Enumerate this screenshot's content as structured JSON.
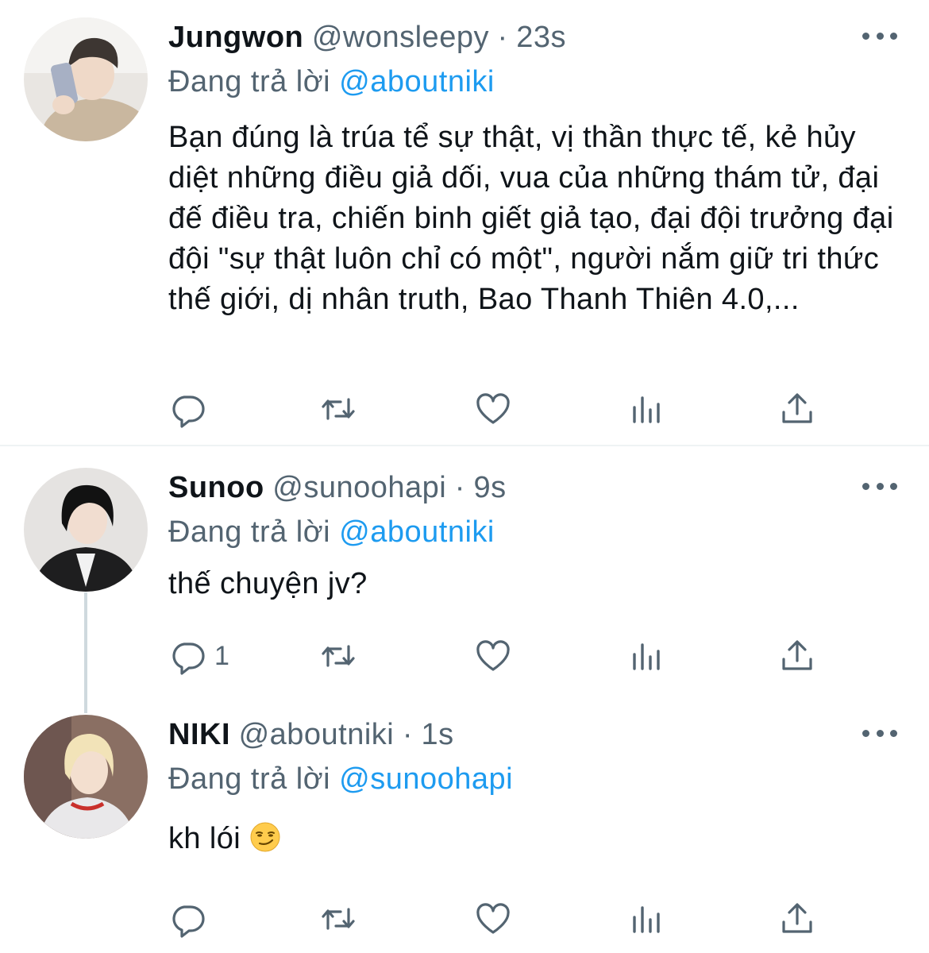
{
  "tweets": [
    {
      "name": "Jungwon",
      "handle": "@wonsleepy",
      "separator": "·",
      "time": "23s",
      "replying_prefix": "Đang trả lời",
      "replying_to": "@aboutniki",
      "text": "Bạn đúng là trúa tể sự thật, vị thần thực tế, kẻ hủy diệt những điều giả dối, vua của những thám tử, đại đế điều tra, chiến binh giết giả tạo, đại đội trưởng đại đội \"sự thật luôn chỉ có một\", người nắm giữ tri thức thế giới, dị nhân truth, Bao Thanh Thiên 4.0,...",
      "reply_count": ""
    },
    {
      "name": "Sunoo",
      "handle": "@sunoohapi",
      "separator": "·",
      "time": "9s",
      "replying_prefix": "Đang trả lời",
      "replying_to": "@aboutniki",
      "text": "thế chuyện jv?",
      "reply_count": "1"
    },
    {
      "name": "NIKI",
      "handle": "@aboutniki",
      "separator": "·",
      "time": "1s",
      "replying_prefix": "Đang trả lời",
      "replying_to": "@sunoohapi",
      "text": "kh lói",
      "emoji": "smirking-face",
      "reply_count": ""
    }
  ],
  "icons": [
    "reply-icon",
    "retweet-icon",
    "like-icon",
    "analytics-icon",
    "share-icon",
    "more-icon"
  ],
  "colors": {
    "text": "#0f1419",
    "secondary": "#536471",
    "mention": "#1d9bf0",
    "divider": "#eff3f4",
    "thread_line": "#cfd9de"
  }
}
